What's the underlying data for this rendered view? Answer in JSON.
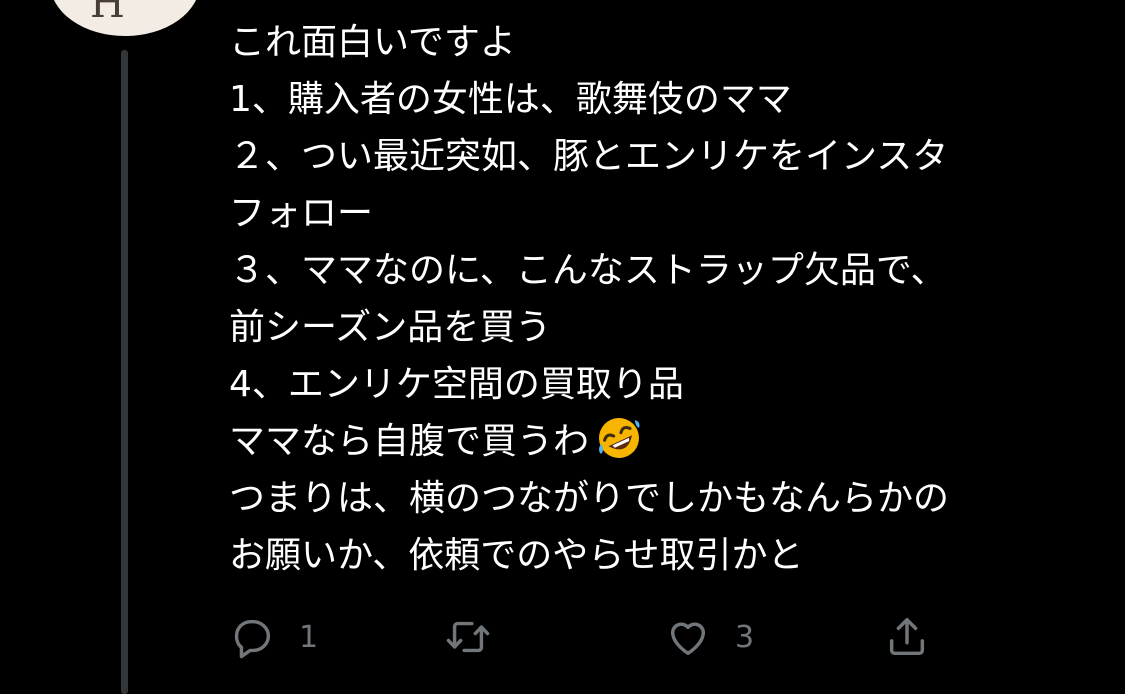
{
  "author": {
    "avatar_glyph": "H"
  },
  "tweet": {
    "lines": [
      "これ面白いですよ",
      "1、購入者の女性は、歌舞伎のママ",
      " ２、つい最近突如、豚とエンリケをインスタ",
      "フォロー",
      " ３、ママなのに、こんなストラップ欠品で、",
      "前シーズン品を買う",
      "4、エンリケ空間の買取り品",
      "ママなら自腹で買うわ",
      "つまりは、横のつながりでしかもなんらかの",
      "お願いか、依頼でのやらせ取引かと"
    ],
    "emoji": "rolling-on-the-floor-laughing"
  },
  "actions": {
    "reply_icon": "reply-icon",
    "reply_count": "1",
    "retweet_icon": "retweet-icon",
    "retweet_count": "",
    "like_icon": "heart-icon",
    "like_count": "3",
    "share_icon": "share-icon"
  },
  "colors": {
    "background": "#000000",
    "text": "#ffffff",
    "muted": "#71767b",
    "thread_line": "#333639",
    "emoji_face": "#f7b500"
  }
}
